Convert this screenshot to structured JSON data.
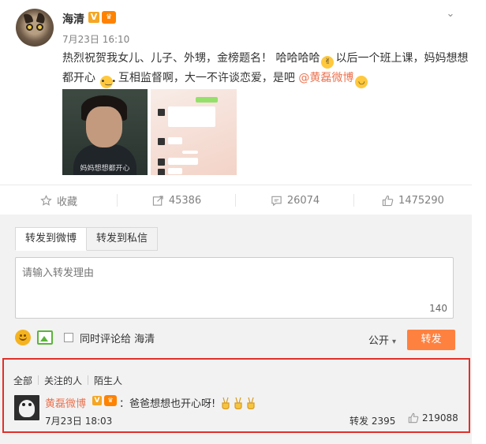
{
  "post": {
    "username": "海清",
    "time": "7月23日 16:10",
    "text_part1": "热烈祝贺我女儿、儿子、外甥，金榜题名！ 哈哈哈哈",
    "text_part2": "以后一个班上课，妈妈想想都开心",
    "text_part3": "互相监督啊，大一不许谈恋爱，是吧",
    "mention": "@黄磊微博",
    "image1_caption": "妈妈想想都开心"
  },
  "actions": {
    "favorite": "收藏",
    "forward_count": "45386",
    "comment_count": "26074",
    "like_count": "1475290"
  },
  "forward_panel": {
    "tab_weibo": "转发到微博",
    "tab_private": "转发到私信",
    "placeholder": "请输入转发理由",
    "counter": "140",
    "also_comment_label": "同时评论给 海清",
    "visibility": "公开",
    "forward_button": "转发"
  },
  "filter": {
    "all": "全部",
    "following": "关注的人",
    "strangers": "陌生人"
  },
  "comment": {
    "username": "黄磊微博",
    "text": "：爸爸想想也开心呀!",
    "time": "7月23日 18:03",
    "forward": "转发 2395",
    "likes": "219088"
  },
  "colors": {
    "accent_orange": "#ff8140",
    "link": "#eb7350",
    "highlight_border": "#e0302a",
    "verified": "#f5a623"
  }
}
